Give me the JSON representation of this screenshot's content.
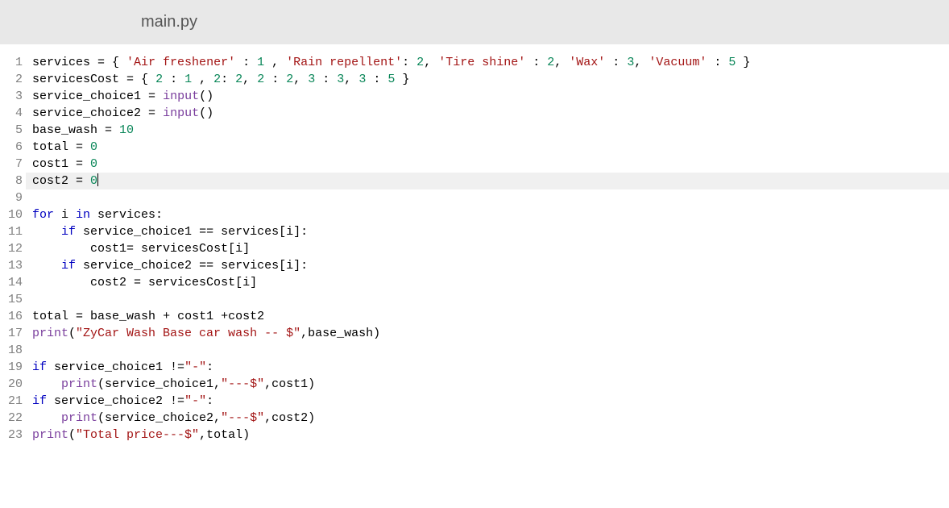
{
  "tab": {
    "filename": "main.py"
  },
  "code": {
    "lines": [
      {
        "num": "1",
        "tokens": [
          {
            "t": "services ",
            "c": ""
          },
          {
            "t": "=",
            "c": "op"
          },
          {
            "t": " { ",
            "c": ""
          },
          {
            "t": "'Air freshener'",
            "c": "str"
          },
          {
            "t": " : ",
            "c": ""
          },
          {
            "t": "1",
            "c": "num"
          },
          {
            "t": " , ",
            "c": ""
          },
          {
            "t": "'Rain repellent'",
            "c": "str"
          },
          {
            "t": ": ",
            "c": ""
          },
          {
            "t": "2",
            "c": "num"
          },
          {
            "t": ", ",
            "c": ""
          },
          {
            "t": "'Tire shine'",
            "c": "str"
          },
          {
            "t": " : ",
            "c": ""
          },
          {
            "t": "2",
            "c": "num"
          },
          {
            "t": ", ",
            "c": ""
          },
          {
            "t": "'Wax'",
            "c": "str"
          },
          {
            "t": " : ",
            "c": ""
          },
          {
            "t": "3",
            "c": "num"
          },
          {
            "t": ", ",
            "c": ""
          },
          {
            "t": "'Vacuum'",
            "c": "str"
          },
          {
            "t": " : ",
            "c": ""
          },
          {
            "t": "5",
            "c": "num"
          },
          {
            "t": " }",
            "c": ""
          }
        ]
      },
      {
        "num": "2",
        "tokens": [
          {
            "t": "servicesCost ",
            "c": ""
          },
          {
            "t": "=",
            "c": "op"
          },
          {
            "t": " { ",
            "c": ""
          },
          {
            "t": "2",
            "c": "num"
          },
          {
            "t": " : ",
            "c": ""
          },
          {
            "t": "1",
            "c": "num"
          },
          {
            "t": " , ",
            "c": ""
          },
          {
            "t": "2",
            "c": "num"
          },
          {
            "t": ": ",
            "c": ""
          },
          {
            "t": "2",
            "c": "num"
          },
          {
            "t": ", ",
            "c": ""
          },
          {
            "t": "2",
            "c": "num"
          },
          {
            "t": " : ",
            "c": ""
          },
          {
            "t": "2",
            "c": "num"
          },
          {
            "t": ", ",
            "c": ""
          },
          {
            "t": "3",
            "c": "num"
          },
          {
            "t": " : ",
            "c": ""
          },
          {
            "t": "3",
            "c": "num"
          },
          {
            "t": ", ",
            "c": ""
          },
          {
            "t": "3",
            "c": "num"
          },
          {
            "t": " : ",
            "c": ""
          },
          {
            "t": "5",
            "c": "num"
          },
          {
            "t": " }",
            "c": ""
          }
        ]
      },
      {
        "num": "3",
        "tokens": [
          {
            "t": "service_choice1 ",
            "c": ""
          },
          {
            "t": "=",
            "c": "op"
          },
          {
            "t": " ",
            "c": ""
          },
          {
            "t": "input",
            "c": "fn"
          },
          {
            "t": "()",
            "c": ""
          }
        ]
      },
      {
        "num": "4",
        "tokens": [
          {
            "t": "service_choice2 ",
            "c": ""
          },
          {
            "t": "=",
            "c": "op"
          },
          {
            "t": " ",
            "c": ""
          },
          {
            "t": "input",
            "c": "fn"
          },
          {
            "t": "()",
            "c": ""
          }
        ]
      },
      {
        "num": "5",
        "tokens": [
          {
            "t": "base_wash ",
            "c": ""
          },
          {
            "t": "=",
            "c": "op"
          },
          {
            "t": " ",
            "c": ""
          },
          {
            "t": "10",
            "c": "num"
          }
        ]
      },
      {
        "num": "6",
        "tokens": [
          {
            "t": "total ",
            "c": ""
          },
          {
            "t": "=",
            "c": "op"
          },
          {
            "t": " ",
            "c": ""
          },
          {
            "t": "0",
            "c": "num"
          }
        ]
      },
      {
        "num": "7",
        "tokens": [
          {
            "t": "cost1 ",
            "c": ""
          },
          {
            "t": "=",
            "c": "op"
          },
          {
            "t": " ",
            "c": ""
          },
          {
            "t": "0",
            "c": "num"
          }
        ]
      },
      {
        "num": "8",
        "highlighted": true,
        "cursor": true,
        "tokens": [
          {
            "t": "cost2 ",
            "c": ""
          },
          {
            "t": "=",
            "c": "op"
          },
          {
            "t": " ",
            "c": ""
          },
          {
            "t": "0",
            "c": "num"
          }
        ]
      },
      {
        "num": "9",
        "tokens": []
      },
      {
        "num": "10",
        "tokens": [
          {
            "t": "for",
            "c": "kw"
          },
          {
            "t": " i ",
            "c": ""
          },
          {
            "t": "in",
            "c": "kw"
          },
          {
            "t": " services:",
            "c": ""
          }
        ]
      },
      {
        "num": "11",
        "tokens": [
          {
            "t": "    ",
            "c": ""
          },
          {
            "t": "if",
            "c": "kw"
          },
          {
            "t": " service_choice1 ",
            "c": ""
          },
          {
            "t": "==",
            "c": "op"
          },
          {
            "t": " services[i]:",
            "c": ""
          }
        ]
      },
      {
        "num": "12",
        "tokens": [
          {
            "t": "        cost1",
            "c": ""
          },
          {
            "t": "=",
            "c": "op"
          },
          {
            "t": " servicesCost[i]",
            "c": ""
          }
        ]
      },
      {
        "num": "13",
        "tokens": [
          {
            "t": "    ",
            "c": ""
          },
          {
            "t": "if",
            "c": "kw"
          },
          {
            "t": " service_choice2 ",
            "c": ""
          },
          {
            "t": "==",
            "c": "op"
          },
          {
            "t": " services[i]:",
            "c": ""
          }
        ]
      },
      {
        "num": "14",
        "tokens": [
          {
            "t": "        cost2 ",
            "c": ""
          },
          {
            "t": "=",
            "c": "op"
          },
          {
            "t": " servicesCost[i]",
            "c": ""
          }
        ]
      },
      {
        "num": "15",
        "tokens": []
      },
      {
        "num": "16",
        "tokens": [
          {
            "t": "total ",
            "c": ""
          },
          {
            "t": "=",
            "c": "op"
          },
          {
            "t": " base_wash ",
            "c": ""
          },
          {
            "t": "+",
            "c": "op"
          },
          {
            "t": " cost1 ",
            "c": ""
          },
          {
            "t": "+",
            "c": "op"
          },
          {
            "t": "cost2",
            "c": ""
          }
        ]
      },
      {
        "num": "17",
        "tokens": [
          {
            "t": "print",
            "c": "fn"
          },
          {
            "t": "(",
            "c": ""
          },
          {
            "t": "\"ZyCar Wash Base car wash -- $\"",
            "c": "str"
          },
          {
            "t": ",base_wash)",
            "c": ""
          }
        ]
      },
      {
        "num": "18",
        "tokens": []
      },
      {
        "num": "19",
        "tokens": [
          {
            "t": "if",
            "c": "kw"
          },
          {
            "t": " service_choice1 ",
            "c": ""
          },
          {
            "t": "!=",
            "c": "op"
          },
          {
            "t": "\"-\"",
            "c": "str"
          },
          {
            "t": ":",
            "c": ""
          }
        ]
      },
      {
        "num": "20",
        "tokens": [
          {
            "t": "    ",
            "c": ""
          },
          {
            "t": "print",
            "c": "fn"
          },
          {
            "t": "(service_choice1,",
            "c": ""
          },
          {
            "t": "\"---$\"",
            "c": "str"
          },
          {
            "t": ",cost1)",
            "c": ""
          }
        ]
      },
      {
        "num": "21",
        "tokens": [
          {
            "t": "if",
            "c": "kw"
          },
          {
            "t": " service_choice2 ",
            "c": ""
          },
          {
            "t": "!=",
            "c": "op"
          },
          {
            "t": "\"-\"",
            "c": "str"
          },
          {
            "t": ":",
            "c": ""
          }
        ]
      },
      {
        "num": "22",
        "tokens": [
          {
            "t": "    ",
            "c": ""
          },
          {
            "t": "print",
            "c": "fn"
          },
          {
            "t": "(service_choice2,",
            "c": ""
          },
          {
            "t": "\"---$\"",
            "c": "str"
          },
          {
            "t": ",cost2)",
            "c": ""
          }
        ]
      },
      {
        "num": "23",
        "tokens": [
          {
            "t": "print",
            "c": "fn"
          },
          {
            "t": "(",
            "c": ""
          },
          {
            "t": "\"Total price---$\"",
            "c": "str"
          },
          {
            "t": ",total)",
            "c": ""
          }
        ]
      }
    ]
  }
}
